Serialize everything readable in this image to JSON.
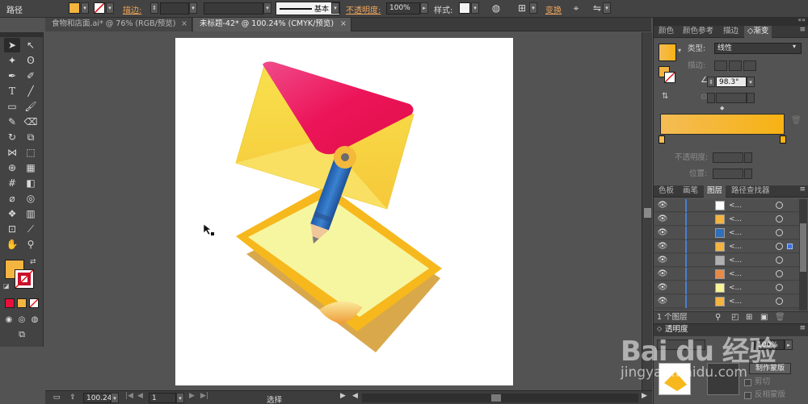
{
  "control_bar": {
    "selection_type": "路径",
    "stroke_label": "描边:",
    "stroke_profile": "基本",
    "opacity_label": "不透明度:",
    "opacity_value": "100%",
    "style_label": "样式:",
    "transform_label": "变换",
    "fill_color": "#f4b440"
  },
  "document_tabs": [
    {
      "label": "食物和店面.ai* @ 76% (RGB/预览)",
      "active": false
    },
    {
      "label": "未标题-42* @ 100.24% (CMYK/预览)",
      "active": true
    }
  ],
  "tools_fill_color": "#f4b440",
  "tools_stroke_color": "#c8102e",
  "status_bar": {
    "zoom": "100.24",
    "artboard_number": "1",
    "current_tool": "选择"
  },
  "color_panel_tabs": [
    {
      "label": "颜色",
      "active": false
    },
    {
      "label": "颜色参考",
      "active": false
    },
    {
      "label": "描边",
      "active": false
    },
    {
      "label": "渐变",
      "active": true
    }
  ],
  "gradient_panel": {
    "type_label": "类型:",
    "type_value": "线性",
    "stroke_label": "描边:",
    "angle_value": "98.3°",
    "opacity_label": "不透明度:",
    "location_label": "位置:",
    "gradient_start_color": "#f4bc55",
    "gradient_end_color": "#f7b213"
  },
  "layers_panel_tabs": [
    {
      "label": "色板",
      "active": false
    },
    {
      "label": "画笔",
      "active": false
    },
    {
      "label": "图层",
      "active": true
    },
    {
      "label": "路径查找器",
      "active": false
    }
  ],
  "layers": [
    {
      "name": "<...",
      "swatch": "#ffffff"
    },
    {
      "name": "<...",
      "swatch": "#f4b440"
    },
    {
      "name": "<...",
      "swatch": "#2f6fba"
    },
    {
      "name": "<...",
      "swatch": "#f4b440"
    },
    {
      "name": "<...",
      "swatch": "#b0b0b0"
    },
    {
      "name": "<...",
      "swatch": "#e8894a"
    },
    {
      "name": "<...",
      "swatch": "#f8f39a"
    },
    {
      "name": "<...",
      "swatch": "#f4b440"
    }
  ],
  "layers_count_label": "1 个图层",
  "transparency_panel": {
    "title": "透明度",
    "opacity_value": "100%",
    "make_mask_button": "制作蒙版",
    "clip_label": "剪切",
    "invert_mask_label": "反相蒙版"
  },
  "watermark": {
    "brand": "Bai du 经验",
    "url": "jingyan.baidu.com"
  },
  "artwork": {
    "envelope_color": "#f7d94a",
    "envelope_flap_color": "#ec1656",
    "pencil_color": "#2d6fb9",
    "note_frame_color": "#f6b81d",
    "note_fill_color": "#f7f59e",
    "note_shadow_color": "#d9a94a"
  }
}
